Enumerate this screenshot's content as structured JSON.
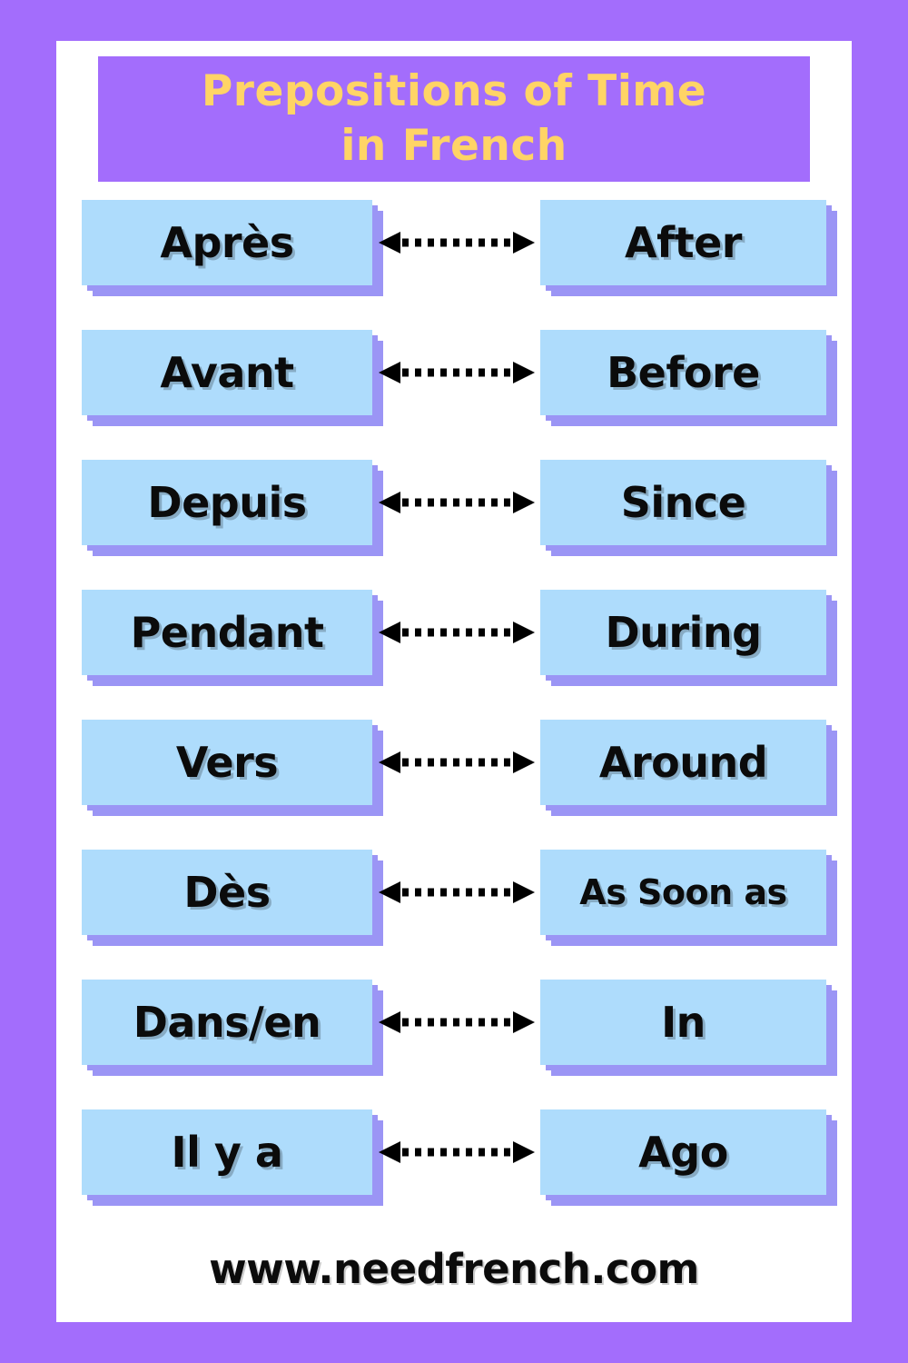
{
  "poster": {
    "title_line1": "Prepositions of Time",
    "title_line2": "in French",
    "footer": "www.needfrench.com",
    "colors": {
      "background_purple": "#a36dfc",
      "panel_white": "#ffffff",
      "box_blue": "#aedcfc",
      "box_shadow_purple": "#9b95f5",
      "title_text_yellow": "#ffd466",
      "body_text_black": "#0b0b0b"
    }
  },
  "rows": [
    {
      "french": "Après",
      "english": "After",
      "arrow": "double-headed-dotted-arrow"
    },
    {
      "french": "Avant",
      "english": "Before",
      "arrow": "double-headed-dotted-arrow"
    },
    {
      "french": "Depuis",
      "english": "Since",
      "arrow": "double-headed-dotted-arrow"
    },
    {
      "french": "Pendant",
      "english": "During",
      "arrow": "double-headed-dotted-arrow"
    },
    {
      "french": "Vers",
      "english": "Around",
      "arrow": "double-headed-dotted-arrow"
    },
    {
      "french": "Dès",
      "english": "As Soon as",
      "arrow": "double-headed-dotted-arrow"
    },
    {
      "french": "Dans/en",
      "english": "In",
      "arrow": "double-headed-dotted-arrow"
    },
    {
      "french": "Il y a",
      "english": "Ago",
      "arrow": "double-headed-dotted-arrow"
    }
  ]
}
